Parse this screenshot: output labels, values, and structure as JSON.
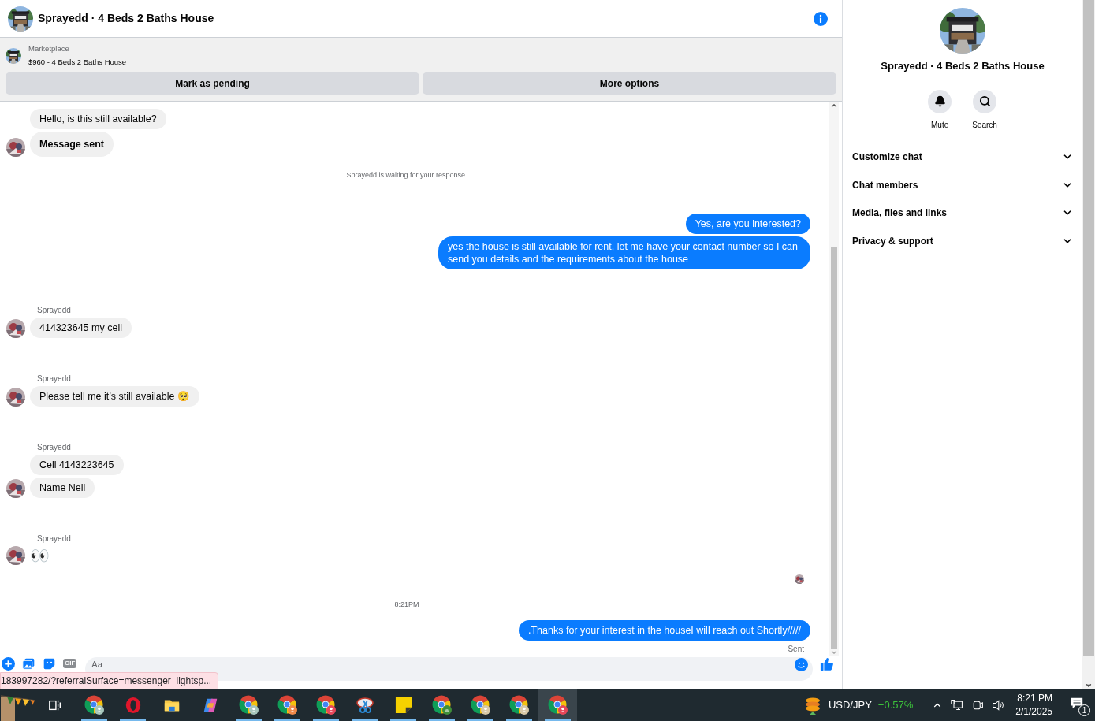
{
  "header": {
    "title": "Sprayedd · 4 Beds 2 Baths House"
  },
  "listing": {
    "source": "Marketplace",
    "title": "$960 - 4 Beds 2 Baths House",
    "actions": [
      "Mark as pending",
      "More options"
    ]
  },
  "messages": [
    {
      "kind": "incoming",
      "bubbles": [
        {
          "text": "Hello, is this still available?",
          "bold": false
        },
        {
          "text": "Message sent",
          "bold": true
        }
      ]
    },
    {
      "kind": "notice",
      "text": "Sprayedd is waiting for your response."
    },
    {
      "kind": "outgoing",
      "bubbles": [
        {
          "text": "Yes, are you interested?"
        },
        {
          "text": "yes the house is still available for rent, let me have your contact number so I can send you details and the requirements about the house"
        }
      ]
    },
    {
      "kind": "incoming",
      "sender": "Sprayedd",
      "bubbles": [
        {
          "text": "414323645 my cell",
          "bold": false
        }
      ]
    },
    {
      "kind": "incoming",
      "sender": "Sprayedd",
      "bubbles": [
        {
          "text": "Please tell me it’s still available 🥺",
          "bold": false
        }
      ]
    },
    {
      "kind": "incoming",
      "sender": "Sprayedd",
      "bubbles": [
        {
          "text": "Cell 4143223645",
          "bold": false
        },
        {
          "text": "Name Nell",
          "bold": false
        }
      ]
    },
    {
      "kind": "emoji",
      "sender": "Sprayedd",
      "text": "👀"
    },
    {
      "kind": "seen"
    },
    {
      "kind": "time",
      "text": "8:21PM"
    },
    {
      "kind": "outgoing",
      "bubbles": [
        {
          "text": ".Thanks for your interest in the houseI will reach out Shortly/////"
        }
      ],
      "status": "Sent"
    }
  ],
  "composer": {
    "gif_label": "GIF",
    "placeholder": "Aa"
  },
  "status_url": "183997282/?referralSurface=messenger_lightsp...",
  "panel": {
    "title": "Sprayedd · 4 Beds 2 Baths House",
    "actions": [
      {
        "kind": "mute",
        "label": "Mute"
      },
      {
        "kind": "search",
        "label": "Search"
      }
    ],
    "sections": [
      {
        "label": "Customize chat",
        "expanded": false
      },
      {
        "label": "Chat members",
        "expanded": false
      },
      {
        "label": "Media, files and links",
        "expanded": false
      },
      {
        "label": "Privacy & support",
        "expanded": false
      }
    ]
  },
  "taskbar": {
    "apps": [
      {
        "kind": "widget",
        "running": false,
        "selected": false
      },
      {
        "kind": "task_view",
        "running": false,
        "selected": false
      },
      {
        "kind": "chrome",
        "running": true,
        "selected": false,
        "color": "#a7c7bd"
      },
      {
        "kind": "opera",
        "running": true,
        "selected": false
      },
      {
        "kind": "files",
        "running": false,
        "selected": false
      },
      {
        "kind": "copilot",
        "running": false,
        "selected": false
      },
      {
        "kind": "chrome",
        "running": true,
        "selected": false,
        "color": "#a7c7bd"
      },
      {
        "kind": "chrome",
        "running": true,
        "selected": false,
        "color": "#f08a4b"
      },
      {
        "kind": "chrome",
        "running": true,
        "selected": false,
        "color": "#e8475a"
      },
      {
        "kind": "snip",
        "running": true,
        "selected": false
      },
      {
        "kind": "notes",
        "running": true,
        "selected": false
      },
      {
        "kind": "chrome",
        "running": true,
        "selected": false,
        "color": "#3f8f3a",
        "badge_text": "w"
      },
      {
        "kind": "chrome",
        "running": true,
        "selected": false,
        "color": "#d8c9a8"
      },
      {
        "kind": "chrome",
        "running": true,
        "selected": false,
        "color": "#d8c9a8"
      },
      {
        "kind": "chrome",
        "running": true,
        "selected": true,
        "color": "#e8475a"
      }
    ],
    "ticker": {
      "symbol": "USD/JPY",
      "change": "+0.57%"
    },
    "time": "8:21 PM",
    "date": "2/1/2025",
    "notifications": "1"
  }
}
